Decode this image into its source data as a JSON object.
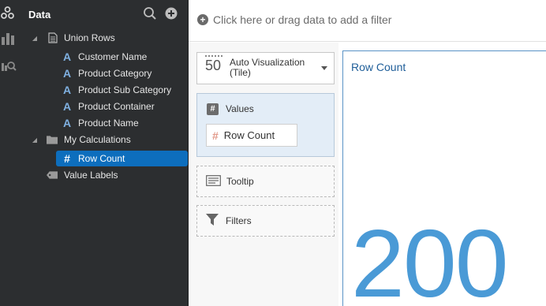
{
  "panel": {
    "title": "Data"
  },
  "tree": {
    "union_rows": "Union Rows",
    "attributes": [
      "Customer Name",
      "Product Category",
      "Product Sub Category",
      "Product Container",
      "Product Name"
    ],
    "my_calculations": "My Calculations",
    "row_count": "Row Count",
    "value_labels": "Value Labels"
  },
  "filter_bar": {
    "prompt": "Click here or drag data to add a filter"
  },
  "grammar": {
    "viz_type": "Auto Visualization (Tile)",
    "viz_icon_text": "50",
    "values_label": "Values",
    "values_item": "Row Count",
    "tooltip_label": "Tooltip",
    "filters_label": "Filters"
  },
  "canvas": {
    "title": "Row Count",
    "value": "200"
  },
  "colors": {
    "panel_bg": "#2c2e30",
    "selection": "#0d6ebd",
    "accent_blue": "#4a9ad6",
    "values_bg": "#e3edf7"
  }
}
